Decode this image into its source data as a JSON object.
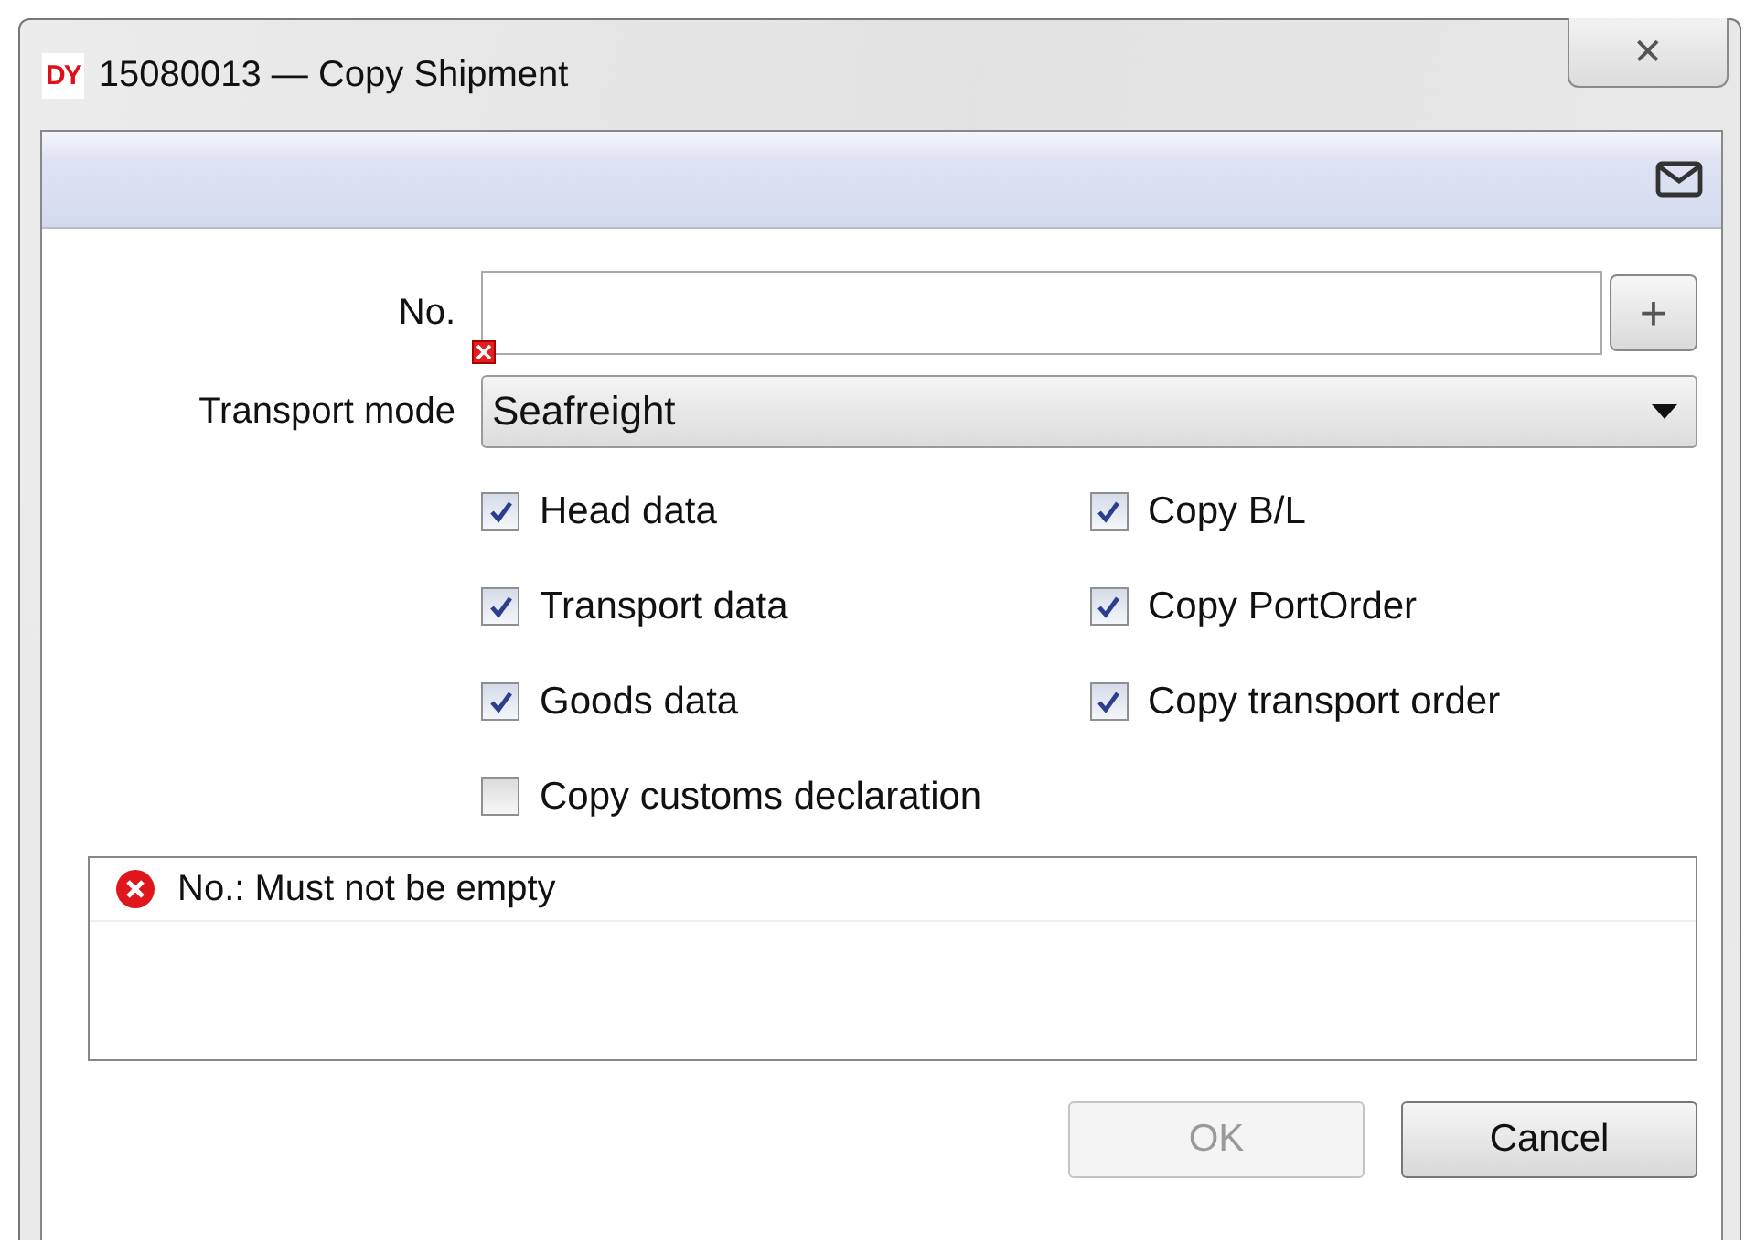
{
  "window": {
    "logo": "DY",
    "title": "15080013 — Copy Shipment",
    "close": "✕"
  },
  "form": {
    "number": {
      "label": "No.",
      "invalid": true,
      "add": "+"
    },
    "transport_mode": {
      "label": "Transport mode",
      "value": "Seafreight"
    }
  },
  "option_columns": [
    [
      {
        "label": "Head data",
        "checked": true
      },
      {
        "label": "Transport data",
        "checked": true
      },
      {
        "label": "Goods data",
        "checked": true
      },
      {
        "label": "Copy customs declaration",
        "checked": false
      }
    ],
    [
      {
        "label": "Copy B/L",
        "checked": true
      },
      {
        "label": "Copy PortOrder",
        "checked": true
      },
      {
        "label": "Copy transport order",
        "checked": true
      }
    ]
  ],
  "messages": [
    {
      "kind": "error",
      "text": "No.: Must not be empty"
    }
  ],
  "buttons": [
    {
      "label": "OK",
      "disabled": true
    },
    {
      "label": "Cancel",
      "disabled": false
    }
  ]
}
